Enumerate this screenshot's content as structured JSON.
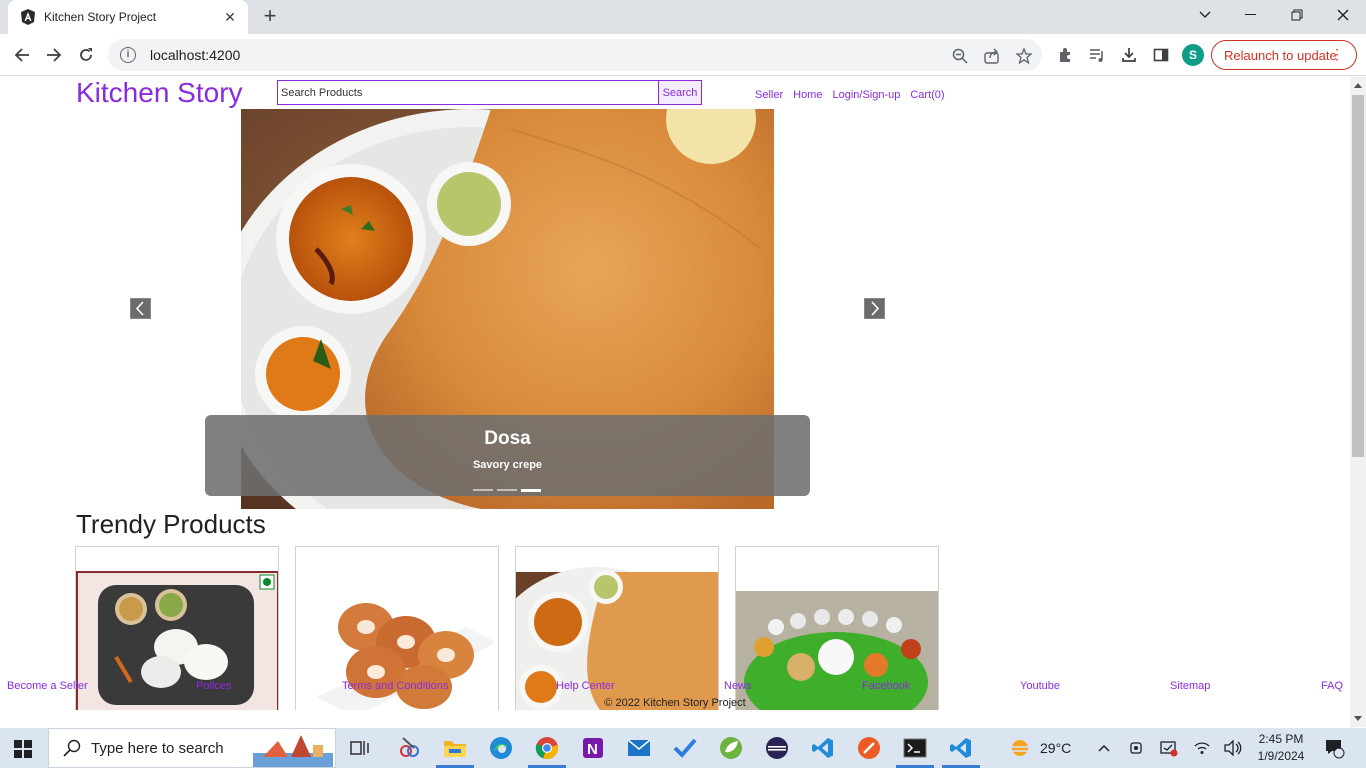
{
  "browser": {
    "tab_title": "Kitchen Story Project",
    "url": "localhost:4200",
    "profile_initial": "S",
    "relaunch_label": "Relaunch to update"
  },
  "header": {
    "brand": "Kitchen Story",
    "search_placeholder": "Search Products",
    "search_button": "Search",
    "nav": [
      "Seller",
      "Home",
      "Login/Sign-up",
      "Cart(0)"
    ]
  },
  "carousel": {
    "title": "Dosa",
    "subtitle": "Savory crepe",
    "slides_count": 3,
    "active_slide": 3
  },
  "trendy": {
    "title": "Trendy Products",
    "items": [
      "idli-sambar",
      "medu-vada",
      "dosa",
      "south-indian-thali"
    ]
  },
  "footer": {
    "links": [
      "Become a Seller",
      "Polices",
      "Terms and Conditions",
      "Help Center",
      "News",
      "Facebook",
      "Youtube",
      "Sitemap",
      "FAQ"
    ],
    "copyright": "© 2022 Kitchen Story Project"
  },
  "taskbar": {
    "search_placeholder": "Type here to search",
    "weather": "29°C",
    "time": "2:45 PM",
    "date": "1/9/2024",
    "notification_count": "4"
  },
  "colors": {
    "accent": "#8a2be2",
    "relaunch": "#d93025"
  }
}
